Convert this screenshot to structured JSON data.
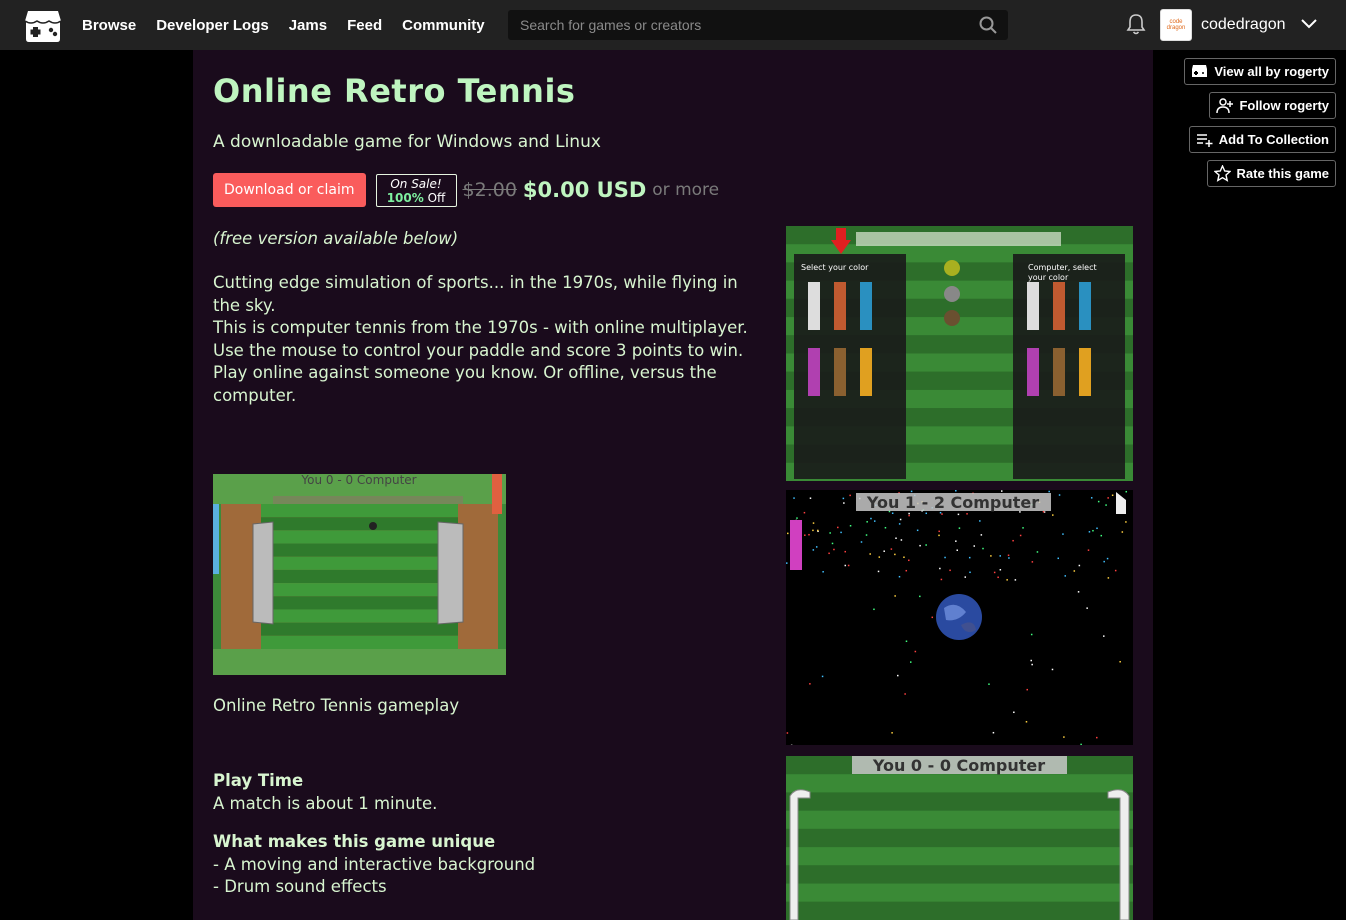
{
  "header": {
    "nav": [
      "Browse",
      "Developer Logs",
      "Jams",
      "Feed",
      "Community"
    ],
    "search_placeholder": "Search for games or creators",
    "username": "codedragon",
    "avatar_text": "code dragon"
  },
  "actions": {
    "view_all": "View all by rogerty",
    "follow": "Follow rogerty",
    "add_collection": "Add To Collection",
    "rate": "Rate this game"
  },
  "game": {
    "title": "Online Retro Tennis",
    "subtitle": "A downloadable game for Windows and Linux",
    "download_label": "Download or claim",
    "sale_label": "On Sale!",
    "sale_pct": "100%",
    "sale_off": "Off",
    "old_price": "$2.00",
    "price": "$0.00 USD",
    "or_more": "or more",
    "free_note": "(free version available below)",
    "description": [
      "Cutting edge simulation of sports... in the 1970s, while flying in the sky.",
      "This is computer tennis from the 1970s - with online multiplayer.",
      "Use the mouse to control your paddle and score 3 points to win.",
      "Play online against someone you know. Or offline, versus the computer."
    ],
    "image_caption": "Online Retro Tennis gameplay",
    "play_time_heading": "Play Time",
    "play_time_text": "A match is about 1 minute.",
    "unique_heading": "What makes this game unique",
    "unique_items": [
      "- A moving and interactive background",
      "- Drum sound effects"
    ]
  },
  "screenshots": {
    "s1_left_label": "Select your color",
    "s1_right_label_1": "Computer, select",
    "s1_right_label_2": "your color",
    "s2_score": "You 1 - 2 Computer",
    "s3_score": "You 0 - 0 Computer",
    "inline_score": "You 0 - 0 Computer"
  },
  "colors": {
    "accent": "#fa5c5c",
    "title": "#bff5c0",
    "text": "#d8f5d0",
    "column_bg": "#1a0b1c",
    "topbar": "#222222"
  }
}
